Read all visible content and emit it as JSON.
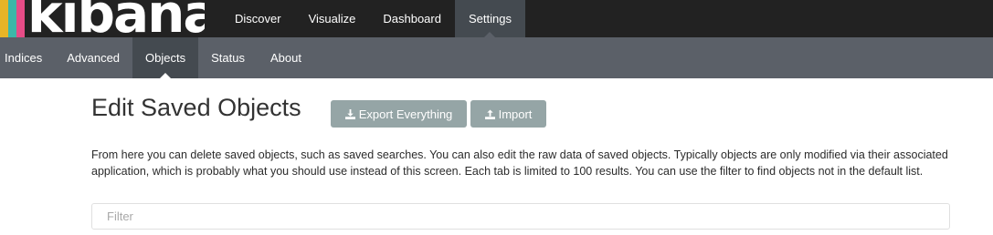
{
  "logo": {
    "text": "kibana"
  },
  "top_nav": {
    "items": [
      {
        "label": "Discover"
      },
      {
        "label": "Visualize"
      },
      {
        "label": "Dashboard"
      },
      {
        "label": "Settings"
      }
    ],
    "active": "Settings"
  },
  "sub_nav": {
    "items": [
      {
        "label": "Indices"
      },
      {
        "label": "Advanced"
      },
      {
        "label": "Objects"
      },
      {
        "label": "Status"
      },
      {
        "label": "About"
      }
    ],
    "active": "Objects"
  },
  "main": {
    "title": "Edit Saved Objects",
    "export_button": {
      "label": "Export Everything",
      "icon": "download-icon"
    },
    "import_button": {
      "label": "Import",
      "icon": "upload-icon"
    },
    "description": "From here you can delete saved objects, such as saved searches. You can also edit the raw data of saved objects. Typically objects are only modified via their associated application, which is probably what you should use instead of this screen. Each tab is limited to 100 results. You can use the filter to find objects not in the default list.",
    "filter": {
      "placeholder": "Filter",
      "value": ""
    }
  },
  "colors": {
    "topbar": "#222222",
    "subbar": "#5b6068",
    "active_tab": "#444a50",
    "button": "#95a5a6",
    "logo_yellow": "#e8b426",
    "logo_teal": "#3cb7a8",
    "logo_pink": "#e64c87"
  }
}
